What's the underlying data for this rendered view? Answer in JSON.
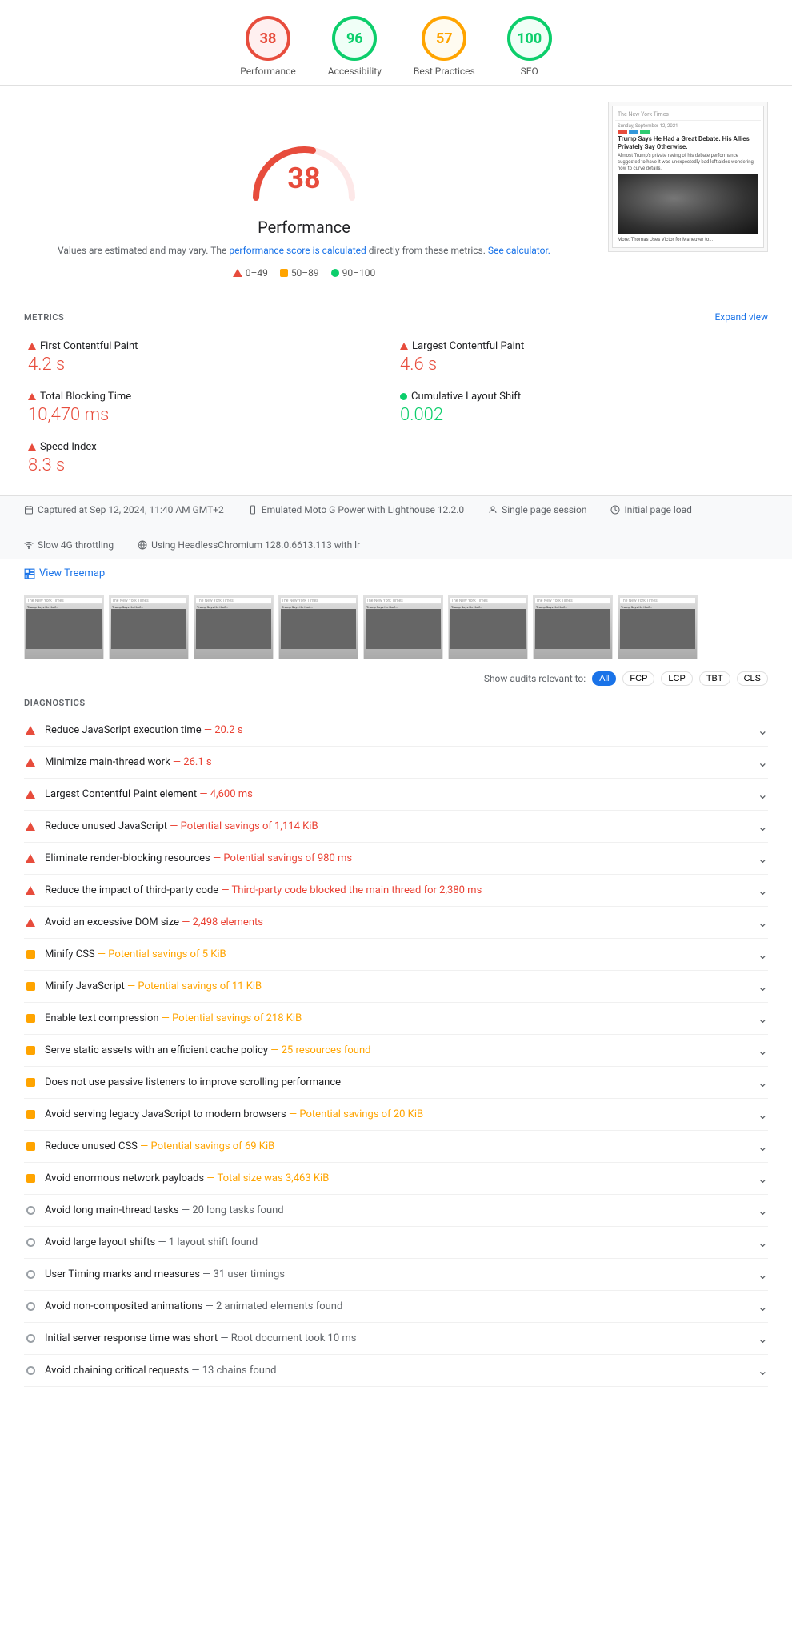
{
  "header": {
    "scores": [
      {
        "id": "performance",
        "value": "38",
        "label": "Performance",
        "type": "red"
      },
      {
        "id": "accessibility",
        "value": "96",
        "label": "Accessibility",
        "type": "green"
      },
      {
        "id": "best-practices",
        "value": "57",
        "label": "Best Practices",
        "type": "orange"
      },
      {
        "id": "seo",
        "value": "100",
        "label": "SEO",
        "type": "green"
      }
    ]
  },
  "performance": {
    "score": "38",
    "title": "Performance",
    "description_start": "Values are estimated and may vary. The",
    "description_link": "performance score is calculated",
    "description_end": "directly from these metrics.",
    "see_calc": "See calculator.",
    "legend": [
      {
        "type": "triangle",
        "range": "0–49"
      },
      {
        "type": "square-orange",
        "range": "50–89"
      },
      {
        "type": "circle-green",
        "range": "90–100"
      }
    ]
  },
  "metrics": {
    "title": "METRICS",
    "expand_label": "Expand view",
    "items": [
      {
        "icon": "triangle-red",
        "label": "First Contentful Paint",
        "value": "4.2 s",
        "color": "red"
      },
      {
        "icon": "triangle-red",
        "label": "Largest Contentful Paint",
        "value": "4.6 s",
        "color": "red"
      },
      {
        "icon": "triangle-red",
        "label": "Total Blocking Time",
        "value": "10,470 ms",
        "color": "red"
      },
      {
        "icon": "circle-green",
        "label": "Cumulative Layout Shift",
        "value": "0.002",
        "color": "green"
      },
      {
        "icon": "triangle-red",
        "label": "Speed Index",
        "value": "8.3 s",
        "color": "red",
        "full": true
      }
    ]
  },
  "info_bar": {
    "items": [
      {
        "icon": "calendar",
        "text": "Captured at Sep 12, 2024, 11:40 AM GMT+2"
      },
      {
        "icon": "device",
        "text": "Emulated Moto G Power with Lighthouse 12.2.0"
      },
      {
        "icon": "user",
        "text": "Single page session"
      },
      {
        "icon": "clock",
        "text": "Initial page load"
      },
      {
        "icon": "wifi",
        "text": "Slow 4G throttling"
      },
      {
        "icon": "browser",
        "text": "Using HeadlessChromium 128.0.6613.113 with lr"
      }
    ]
  },
  "treemap": {
    "link_label": "View Treemap"
  },
  "filter": {
    "label": "Show audits relevant to:",
    "buttons": [
      "All",
      "FCP",
      "LCP",
      "TBT",
      "CLS"
    ],
    "active": "All"
  },
  "diagnostics": {
    "title": "DIAGNOSTICS",
    "items": [
      {
        "icon": "triangle-red",
        "text": "Reduce JavaScript execution time",
        "detail": " — 20.2 s",
        "detail_type": "red"
      },
      {
        "icon": "triangle-red",
        "text": "Minimize main-thread work",
        "detail": " — 26.1 s",
        "detail_type": "red"
      },
      {
        "icon": "triangle-red",
        "text": "Largest Contentful Paint element",
        "detail": " — 4,600 ms",
        "detail_type": "red"
      },
      {
        "icon": "triangle-red",
        "text": "Reduce unused JavaScript",
        "detail": " — Potential savings of 1,114 KiB",
        "detail_type": "red"
      },
      {
        "icon": "triangle-red",
        "text": "Eliminate render-blocking resources",
        "detail": " — Potential savings of 980 ms",
        "detail_type": "red"
      },
      {
        "icon": "triangle-red",
        "text": "Reduce the impact of third-party code",
        "detail": " — Third-party code blocked the main thread for 2,380 ms",
        "detail_type": "red"
      },
      {
        "icon": "triangle-red",
        "text": "Avoid an excessive DOM size",
        "detail": " — 2,498 elements",
        "detail_type": "red"
      },
      {
        "icon": "square-orange",
        "text": "Minify CSS",
        "detail": " — Potential savings of 5 KiB",
        "detail_type": "orange"
      },
      {
        "icon": "square-orange",
        "text": "Minify JavaScript",
        "detail": " — Potential savings of 11 KiB",
        "detail_type": "orange"
      },
      {
        "icon": "square-orange",
        "text": "Enable text compression",
        "detail": " — Potential savings of 218 KiB",
        "detail_type": "orange"
      },
      {
        "icon": "square-orange",
        "text": "Serve static assets with an efficient cache policy",
        "detail": " — 25 resources found",
        "detail_type": "orange"
      },
      {
        "icon": "square-orange",
        "text": "Does not use passive listeners to improve scrolling performance",
        "detail": "",
        "detail_type": ""
      },
      {
        "icon": "square-orange",
        "text": "Avoid serving legacy JavaScript to modern browsers",
        "detail": " — Potential savings of 20 KiB",
        "detail_type": "orange"
      },
      {
        "icon": "square-orange",
        "text": "Reduce unused CSS",
        "detail": " — Potential savings of 69 KiB",
        "detail_type": "orange"
      },
      {
        "icon": "square-orange",
        "text": "Avoid enormous network payloads",
        "detail": " — Total size was 3,463 KiB",
        "detail_type": "orange"
      },
      {
        "icon": "circle-gray",
        "text": "Avoid long main-thread tasks",
        "detail": " — 20 long tasks found",
        "detail_type": "gray"
      },
      {
        "icon": "circle-gray",
        "text": "Avoid large layout shifts",
        "detail": " — 1 layout shift found",
        "detail_type": "gray"
      },
      {
        "icon": "circle-gray",
        "text": "User Timing marks and measures",
        "detail": " — 31 user timings",
        "detail_type": "gray"
      },
      {
        "icon": "circle-gray",
        "text": "Avoid non-composited animations",
        "detail": " — 2 animated elements found",
        "detail_type": "gray"
      },
      {
        "icon": "circle-gray",
        "text": "Initial server response time was short",
        "detail": " — Root document took 10 ms",
        "detail_type": "gray"
      },
      {
        "icon": "circle-gray",
        "text": "Avoid chaining critical requests",
        "detail": " — 13 chains found",
        "detail_type": "gray"
      }
    ]
  }
}
